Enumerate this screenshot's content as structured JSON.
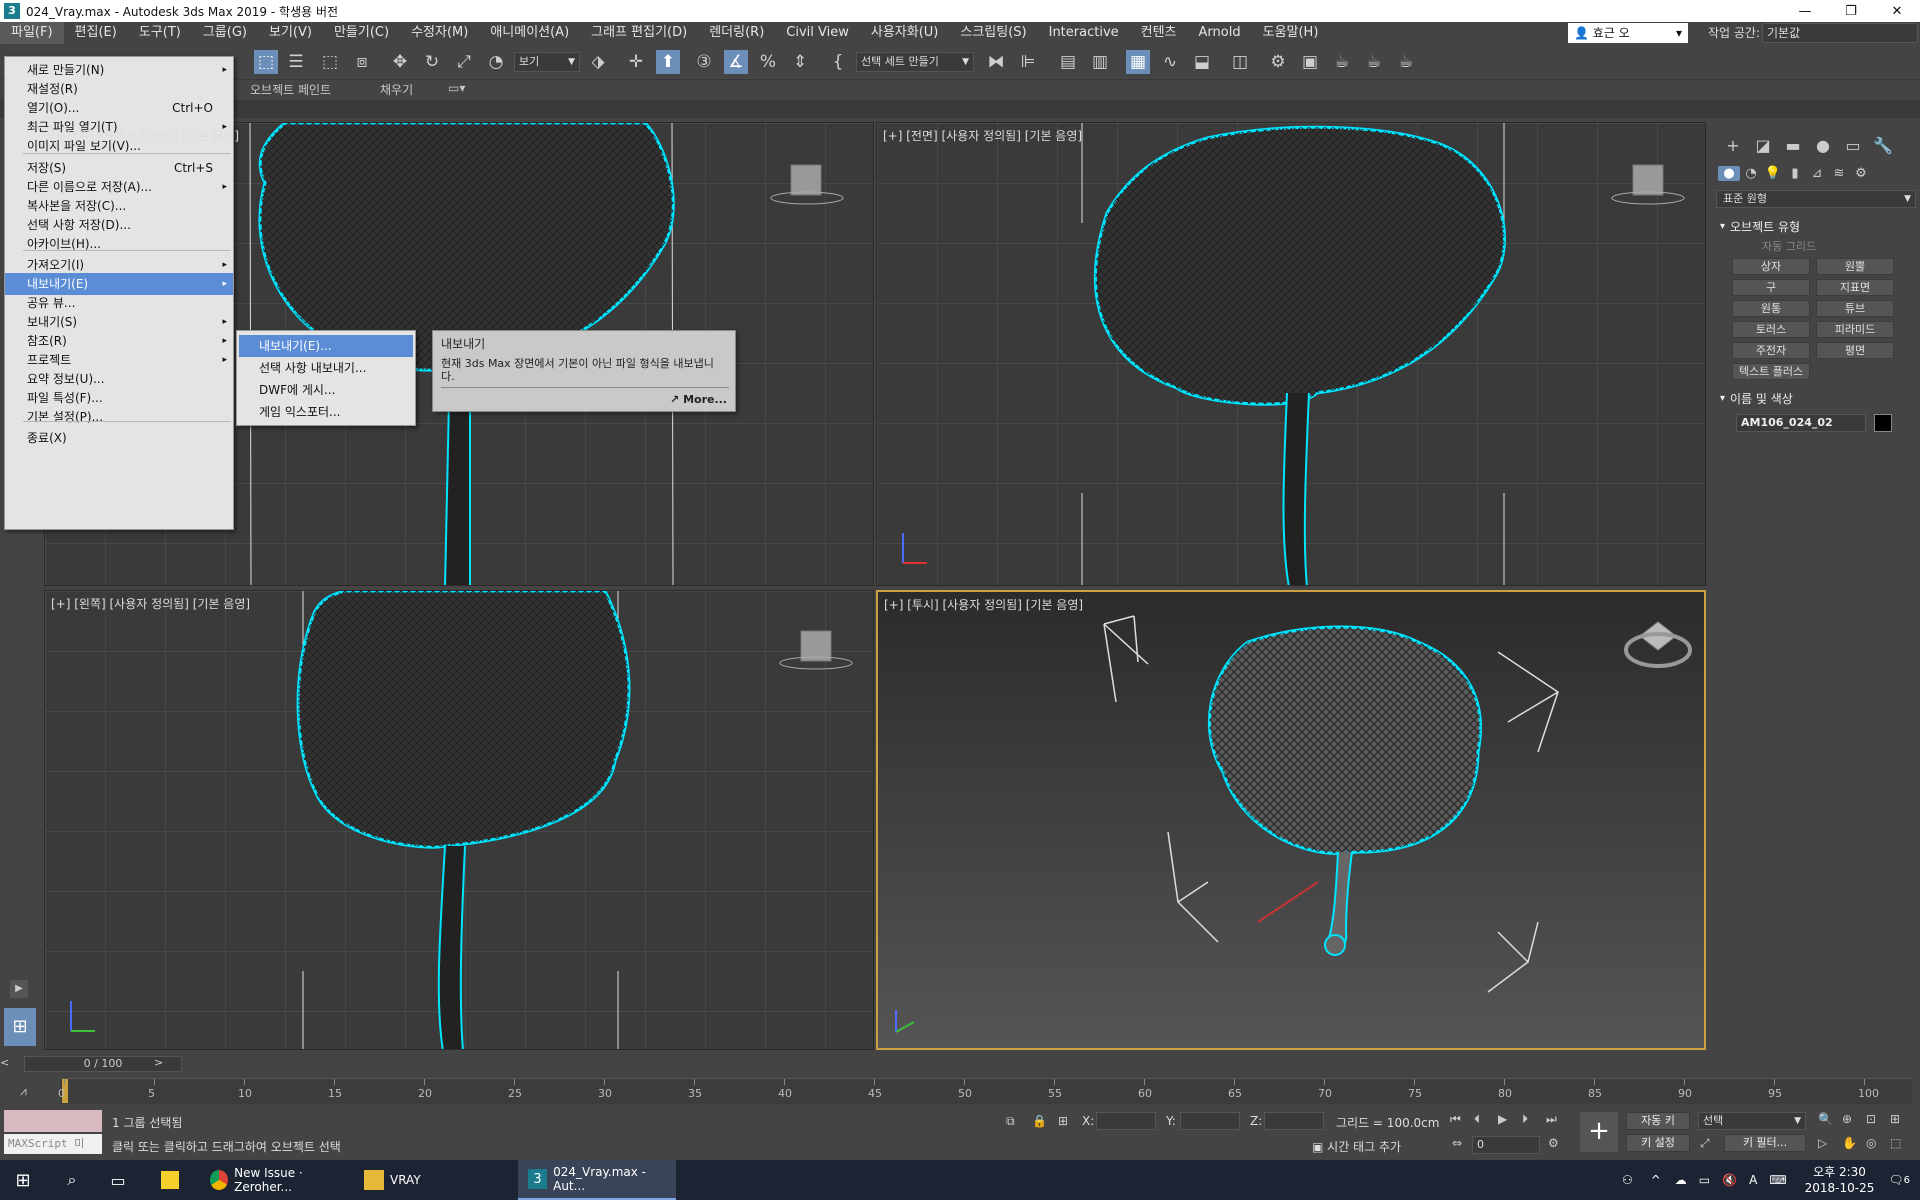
{
  "titlebar": {
    "title": "024_Vray.max - Autodesk 3ds Max 2019 - 학생용 버전",
    "app_icon": "3",
    "minimize": "—",
    "maximize": "❐",
    "close": "✕"
  },
  "menubar": {
    "items": [
      "파일(F)",
      "편집(E)",
      "도구(T)",
      "그룹(G)",
      "보기(V)",
      "만들기(C)",
      "수정자(M)",
      "애니메이션(A)",
      "그래프 편집기(D)",
      "렌더링(R)",
      "Civil View",
      "사용자화(U)",
      "스크립팅(S)",
      "Interactive",
      "컨텐츠",
      "Arnold",
      "도움말(H)"
    ],
    "user": "효근 오",
    "workspace_label": "작업 공간:",
    "workspace_value": "기본값"
  },
  "toolbar": {
    "view_dropdown": "보기",
    "selection_set": "선택 세트 만들기"
  },
  "ribbon": {
    "object_paint": "오브젝트 페인트",
    "fill": "채우기"
  },
  "file_menu": {
    "items": [
      {
        "label": "새로 만들기(N)",
        "shortcut": "",
        "submenu": true
      },
      {
        "label": "재설정(R)",
        "shortcut": "",
        "submenu": false
      },
      {
        "label": "열기(O)...",
        "shortcut": "Ctrl+O",
        "submenu": false
      },
      {
        "label": "최근 파일 열기(T)",
        "shortcut": "",
        "submenu": true
      },
      {
        "label": "이미지 파일 보기(V)...",
        "shortcut": "",
        "submenu": false
      },
      {
        "label": "저장(S)",
        "shortcut": "Ctrl+S",
        "submenu": false
      },
      {
        "label": "다른 이름으로 저장(A)...",
        "shortcut": "",
        "submenu": true
      },
      {
        "label": "복사본을 저장(C)...",
        "shortcut": "",
        "submenu": false
      },
      {
        "label": "선택 사항 저장(D)...",
        "shortcut": "",
        "submenu": false
      },
      {
        "label": "아카이브(H)...",
        "shortcut": "",
        "submenu": false
      },
      {
        "label": "가져오기(I)",
        "shortcut": "",
        "submenu": true
      },
      {
        "label": "내보내기(E)",
        "shortcut": "",
        "submenu": true
      },
      {
        "label": "공유 뷰...",
        "shortcut": "",
        "submenu": false
      },
      {
        "label": "보내기(S)",
        "shortcut": "",
        "submenu": true
      },
      {
        "label": "참조(R)",
        "shortcut": "",
        "submenu": true
      },
      {
        "label": "프로젝트",
        "shortcut": "",
        "submenu": true
      },
      {
        "label": "요약 정보(U)...",
        "shortcut": "",
        "submenu": false
      },
      {
        "label": "파일 특성(F)...",
        "shortcut": "",
        "submenu": false
      },
      {
        "label": "기본 설정(P)...",
        "shortcut": "",
        "submenu": false
      },
      {
        "label": "종료(X)",
        "shortcut": "",
        "submenu": false
      }
    ],
    "submenu_arrow": "▸"
  },
  "export_submenu": {
    "items": [
      "내보내기(E)...",
      "선택 사항 내보내기...",
      "DWF에 게시...",
      "게임 익스포터..."
    ]
  },
  "tooltip": {
    "title": "내보내기",
    "description": "현재 3ds Max 장면에서 기본이 아닌 파일 형식을 내보냅니다.",
    "more": "More..."
  },
  "viewports": {
    "top_left": "[+] [위] [사용자 정의됨] [기본 음영]",
    "front": "[+] [전면] [사용자 정의됨] [기본 음영]",
    "left": "[+] [왼쪽] [사용자 정의됨] [기본 음영]",
    "perspective": "[+] [투시] [사용자 정의됨] [기본 음영]"
  },
  "command_panel": {
    "category": "표준 원형",
    "object_type_header": "오브젝트 유형",
    "autogrid": "자동 그리드",
    "buttons": [
      "상자",
      "원뿔",
      "구",
      "지표면",
      "원통",
      "튜브",
      "토러스",
      "피라미드",
      "주전자",
      "평면",
      "텍스트 플러스"
    ],
    "name_color_header": "이름 및 색상",
    "object_name": "AM106_024_02"
  },
  "timeline": {
    "slider": "0 / 100",
    "ticks": [
      0,
      5,
      10,
      15,
      20,
      25,
      30,
      35,
      40,
      45,
      50,
      55,
      60,
      65,
      70,
      75,
      80,
      85,
      90,
      95,
      100
    ]
  },
  "status": {
    "selected": "1 그룹 선택됨",
    "hint": "클릭 또는 클릭하고 드래그하여 오브젝트 선택",
    "maxscript": "MAXScript 미",
    "x_label": "X:",
    "y_label": "Y:",
    "z_label": "Z:",
    "grid": "그리드 = 100.0cm",
    "add_time_tag": "시간 태그 추가",
    "frame": "0",
    "auto_key": "자동 키",
    "set_key": "키 설정",
    "selection": "선택",
    "key_filters": "키 필터..."
  },
  "taskbar": {
    "items": [
      "New Issue · Zeroher...",
      "VRAY",
      "024_Vray.max - Aut..."
    ],
    "time": "오후 2:30",
    "date": "2018-10-25",
    "notifications": "6"
  }
}
